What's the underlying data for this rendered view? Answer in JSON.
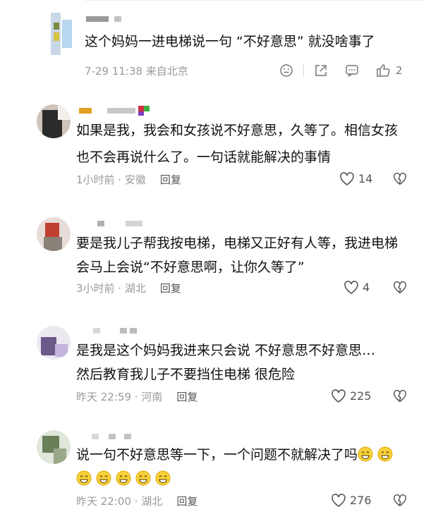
{
  "post": {
    "text": "这个妈妈一进电梯说一句 “不好意思” 就没啥事了",
    "meta": "7-29 11:38 来自北京",
    "like_count": "2",
    "icons": [
      "emoji-icon",
      "share-icon",
      "comment-icon",
      "thumbs-up-icon"
    ]
  },
  "comments": [
    {
      "lines": [
        "如果是我，我会和女孩说不好意思，久等了。相信女孩",
        "也不会再说什么了。一句话就能解决的事情"
      ],
      "time_location": "1小时前 · 安徽",
      "reply_label": "回复",
      "likes": "14"
    },
    {
      "lines": [
        "要是我儿子帮我按电梯，电梯又正好有人等，我进电梯",
        "会马上会说“不好意思啊，让你久等了”"
      ],
      "time_location": "3小时前 · 湖北",
      "reply_label": "回复",
      "likes": "4"
    },
    {
      "lines": [
        "是我是这个妈妈我进来只会说  不好意思不好意思…",
        "然后教育我儿子不要挡住电梯  很危险"
      ],
      "time_location": "昨天 22:59 · 河南",
      "reply_label": "回复",
      "likes": "225"
    },
    {
      "line1": "说一句不好意思等一下，一个问题不就解决了吗",
      "time_location": "昨天 22:00 · 湖北",
      "reply_label": "回复",
      "likes": "276"
    }
  ]
}
